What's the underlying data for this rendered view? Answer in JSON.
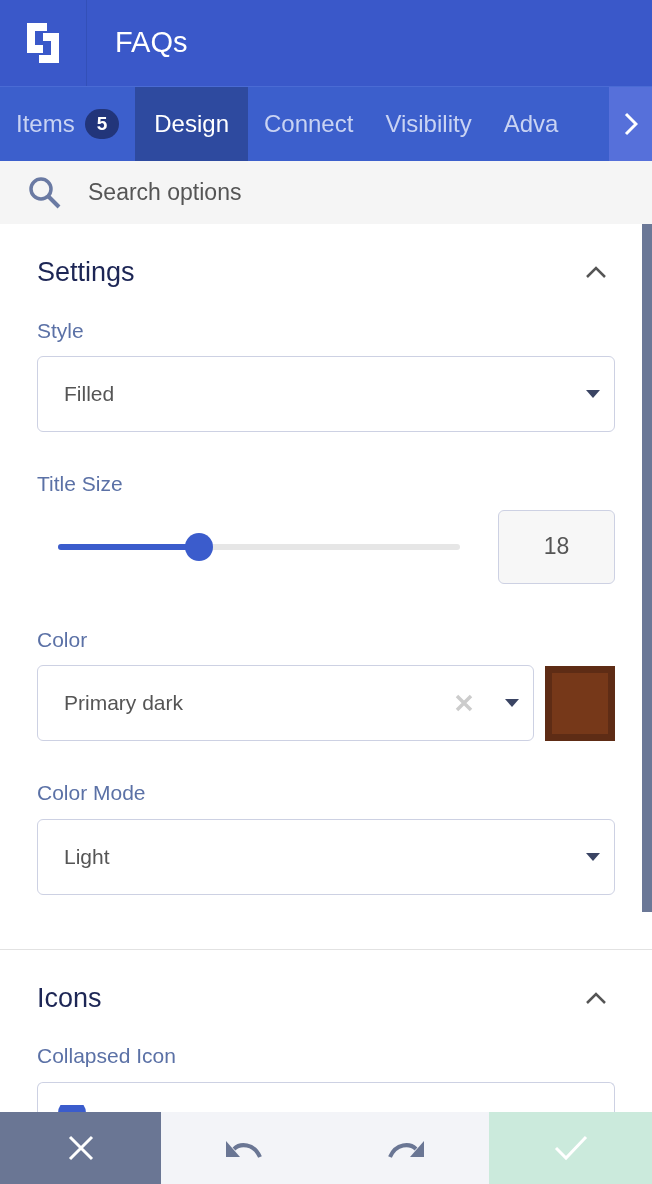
{
  "header": {
    "title": "FAQs"
  },
  "tabs": [
    {
      "label": "Items",
      "badge": "5",
      "selected": false
    },
    {
      "label": "Design",
      "selected": true
    },
    {
      "label": "Connect",
      "selected": false
    },
    {
      "label": "Visibility",
      "selected": false
    },
    {
      "label": "Adva",
      "selected": false
    }
  ],
  "search": {
    "placeholder": "Search options"
  },
  "sections": [
    {
      "title": "Settings",
      "expanded": true,
      "fields": [
        {
          "kind": "select",
          "label": "Style",
          "value": "Filled"
        },
        {
          "kind": "slider",
          "label": "Title Size",
          "level": 0.35,
          "value": "18"
        },
        {
          "kind": "color",
          "label": "Color",
          "value": "Primary dark",
          "color": "#763819"
        },
        {
          "kind": "select",
          "label": "Color Mode",
          "value": "Light"
        }
      ]
    },
    {
      "title": "Icons",
      "expanded": true,
      "fields": [
        {
          "kind": "icon",
          "label": "Collapsed Icon"
        }
      ]
    }
  ]
}
